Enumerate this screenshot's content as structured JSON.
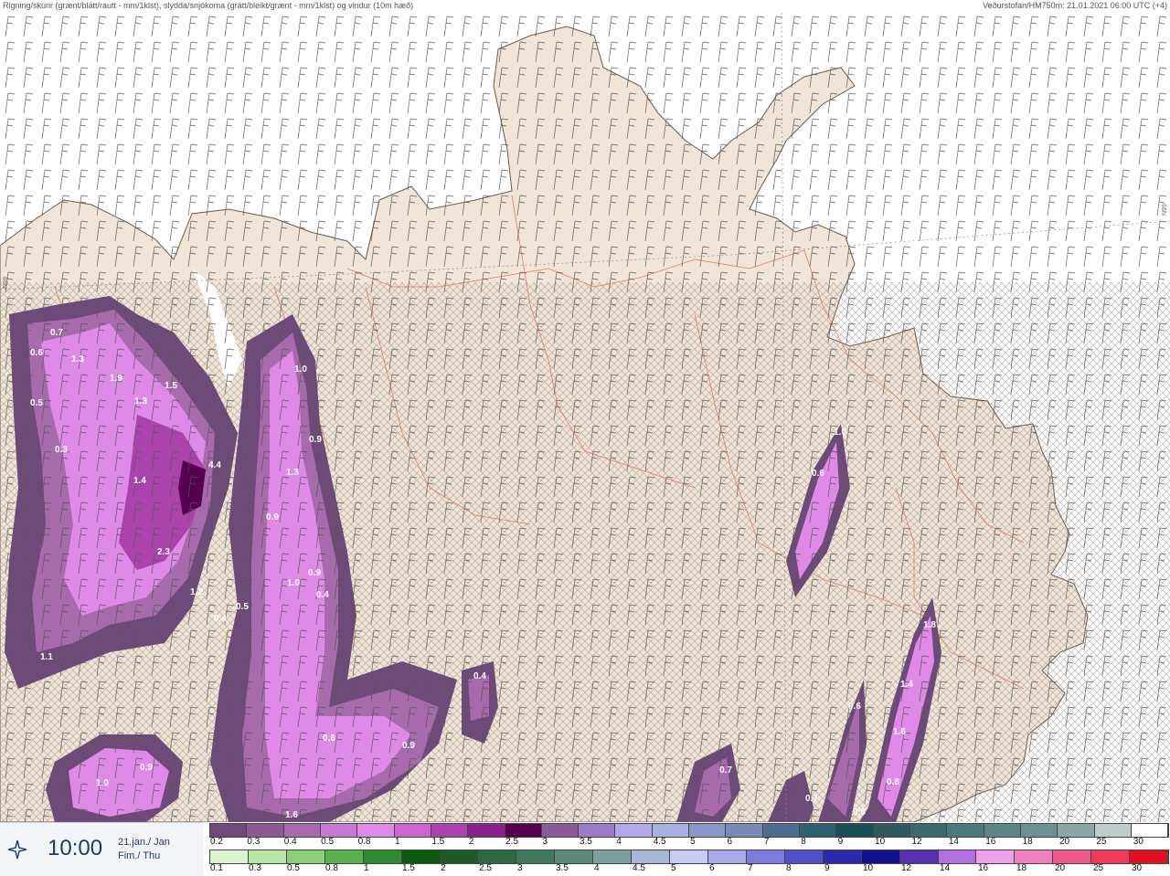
{
  "header": {
    "title": "Rigning/skúrir (grænt/blátt/rautt - mm/1klst), slydda/snjókoma (grátt/bleikt/grænt - mm/1klst) og vindur (10m hæð)",
    "source": "Veðurstofan/HM750m: 21.01.2021 06:00 UTC (+4)"
  },
  "map": {
    "grid_label_left": "N99",
    "grid_label_right": "N99",
    "precip_labels": [
      {
        "v": "0.7"
      },
      {
        "v": "0.6"
      },
      {
        "v": "1.3"
      },
      {
        "v": "1.9"
      },
      {
        "v": "1.5"
      },
      {
        "v": "0.5"
      },
      {
        "v": "1.3"
      },
      {
        "v": "0.3"
      },
      {
        "v": "4.4"
      },
      {
        "v": "1.4"
      },
      {
        "v": "2.3"
      },
      {
        "v": "1.2"
      },
      {
        "v": "0.5"
      },
      {
        "v": "0.4"
      },
      {
        "v": "1.1"
      },
      {
        "v": "1.0"
      },
      {
        "v": "0.9"
      },
      {
        "v": "1.3"
      },
      {
        "v": "0.9"
      },
      {
        "v": "0.9"
      },
      {
        "v": "1.0"
      },
      {
        "v": "0.4"
      },
      {
        "v": "0.4"
      },
      {
        "v": "0.6"
      },
      {
        "v": "0.9"
      },
      {
        "v": "1.0"
      },
      {
        "v": "0.9"
      },
      {
        "v": "1.6"
      },
      {
        "v": "1.0"
      },
      {
        "v": "0.6"
      },
      {
        "v": "1.8"
      },
      {
        "v": "1.4"
      },
      {
        "v": "0.6"
      },
      {
        "v": "1.6"
      },
      {
        "v": "0.7"
      },
      {
        "v": "0.7"
      },
      {
        "v": "0.8"
      },
      {
        "v": "0.8"
      }
    ]
  },
  "footer": {
    "time": "10:00",
    "date_line1": "21.jan./ Jan",
    "date_line2": "Fim./ Thu",
    "snow_scale": {
      "labels": [
        "0.2",
        "0.3",
        "0.4",
        "0.5",
        "0.8",
        "1",
        "1.5",
        "2",
        "2.5",
        "3",
        "3.5",
        "4",
        "4.5",
        "5",
        "6",
        "7",
        "8",
        "9",
        "10",
        "12",
        "14",
        "16",
        "18",
        "20",
        "25",
        "30"
      ],
      "colors": [
        "#6e4a78",
        "#8a5c93",
        "#a66aad",
        "#c47ad0",
        "#e08ae8",
        "#cc66cc",
        "#aa44aa",
        "#882288",
        "#55004f",
        "#8a5a9a",
        "#9d7ac4",
        "#b5a8e8",
        "#a8b0e0",
        "#8a96c8",
        "#7a8ab8",
        "#4d6e8e",
        "#2e6070",
        "#1a4e58",
        "#2f5a5e",
        "#3a6a6a",
        "#4a7a7a",
        "#5a8686",
        "#6a9090",
        "#8aa6a6",
        "#c0cccc",
        "#ffffff"
      ]
    },
    "rain_scale": {
      "labels": [
        "0.1",
        "0.3",
        "0.5",
        "0.8",
        "1",
        "1.5",
        "2",
        "2.5",
        "3",
        "3.5",
        "4",
        "4.5",
        "5",
        "6",
        "7",
        "8",
        "9",
        "10",
        "12",
        "14",
        "16",
        "18",
        "20",
        "25",
        "30"
      ],
      "colors": [
        "#d8f5d0",
        "#b8e6a8",
        "#8ccf7a",
        "#5ab04a",
        "#2e8a2e",
        "#0a5a12",
        "#1f5a2a",
        "#2e6a40",
        "#3e7a5a",
        "#5e8a7a",
        "#7e9ea0",
        "#a8b8d8",
        "#c8ccf5",
        "#a8a8ee",
        "#7c7ce0",
        "#5050cc",
        "#2a2ab0",
        "#101090",
        "#5a30b0",
        "#b070e0",
        "#f0a0e8",
        "#f080c0",
        "#f05a8a",
        "#f03a5a",
        "#e01020"
      ]
    }
  }
}
